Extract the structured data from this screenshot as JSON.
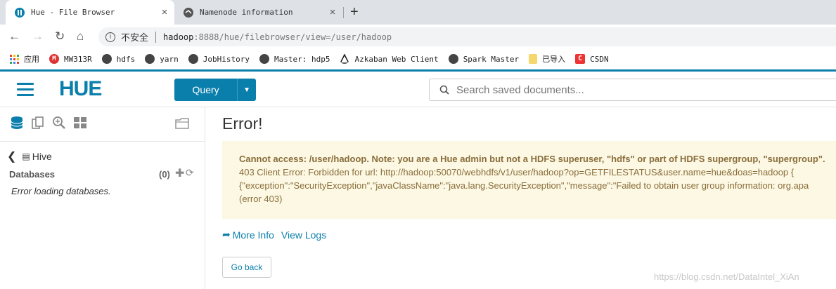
{
  "browser": {
    "tabs": [
      {
        "title": "Hue - File Browser",
        "active": true
      },
      {
        "title": "Namenode information",
        "active": false
      }
    ],
    "address": {
      "security_label": "不安全",
      "url_host": "hadoop",
      "url_rest": ":8888/hue/filebrowser/view=/user/hadoop"
    },
    "bookmarks": [
      "应用",
      "MW313R",
      "hdfs",
      "yarn",
      "JobHistory",
      "Master: hdp5",
      "Azkaban Web Client",
      "Spark Master",
      "已导入",
      "CSDN"
    ]
  },
  "hue": {
    "logo": "HUE",
    "query_label": "Query",
    "search_placeholder": "Search saved documents..."
  },
  "left_panel": {
    "back_label": "Hive",
    "databases_label": "Databases",
    "databases_count": "(0)",
    "error_text": "Error loading databases."
  },
  "main": {
    "title": "Error!",
    "alert": {
      "heading": "Cannot access: /user/hadoop. Note: you are a Hue admin but not a HDFS superuser, \"hdfs\" or part of HDFS supergroup, \"supergroup\".",
      "line1": "403 Client Error: Forbidden for url: http://hadoop:50070/webhdfs/v1/user/hadoop?op=GETFILESTATUS&user.name=hue&doas=hadoop {",
      "line2": "{\"exception\":\"SecurityException\",\"javaClassName\":\"java.lang.SecurityException\",\"message\":\"Failed to obtain user group information: org.apa",
      "line3": "(error 403)"
    },
    "more_info": "More Info",
    "view_logs": "View Logs",
    "go_back": "Go back"
  },
  "watermark": "https://blog.csdn.net/DataIntel_XiAn",
  "colors": {
    "hue_blue": "#0b7fab",
    "alert_bg": "#fcf8e3",
    "alert_text": "#8a6d3b"
  }
}
